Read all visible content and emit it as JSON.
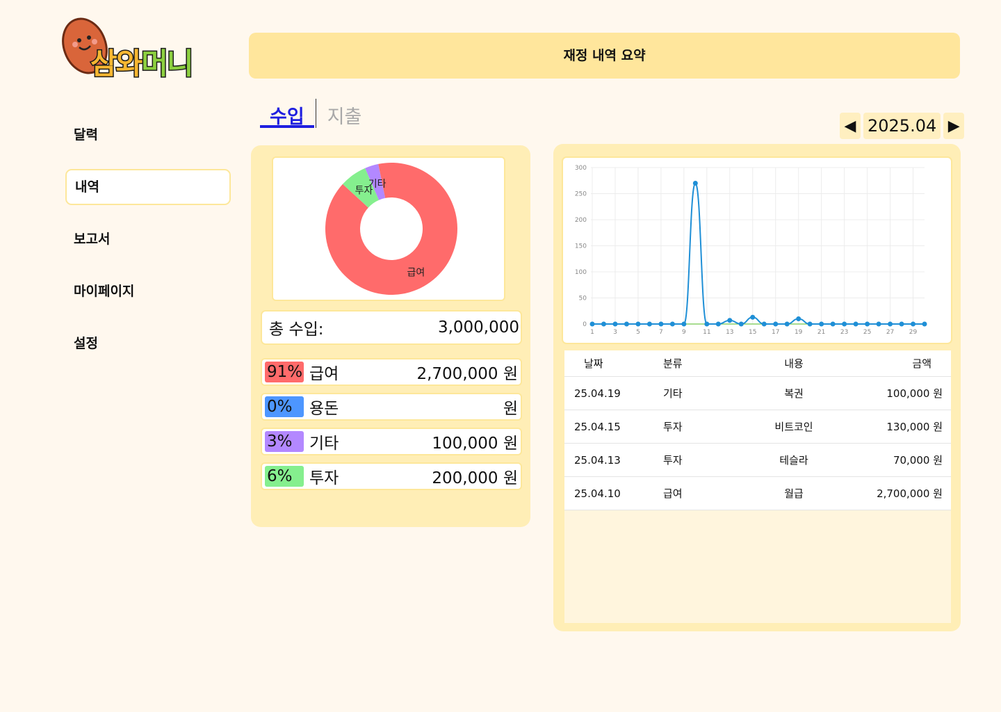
{
  "logo": {
    "text_part1": "삼와",
    "text_part2": "머니"
  },
  "sidebar": {
    "items": [
      {
        "label": "달력",
        "active": false
      },
      {
        "label": "내역",
        "active": true
      },
      {
        "label": "보고서",
        "active": false
      },
      {
        "label": "마이페이지",
        "active": false
      },
      {
        "label": "설정",
        "active": false
      }
    ]
  },
  "header": {
    "title": "재정 내역 요약"
  },
  "tabs": [
    {
      "label": "수입",
      "active": true
    },
    {
      "label": "지출",
      "active": false
    }
  ],
  "month_nav": {
    "prev": "◀",
    "label": "2025.04",
    "next": "▶"
  },
  "summary": {
    "total_label": "총 수입:",
    "total_value": "3,000,000",
    "categories": [
      {
        "pct": "91%",
        "name": "급여",
        "amount": "2,700,000 원",
        "color": "#ff6b6b"
      },
      {
        "pct": "0%",
        "name": "용돈",
        "amount": "원",
        "color": "#4d96ff"
      },
      {
        "pct": "3%",
        "name": "기타",
        "amount": "100,000 원",
        "color": "#b388ff"
      },
      {
        "pct": "6%",
        "name": "투자",
        "amount": "200,000 원",
        "color": "#85ef8e"
      }
    ]
  },
  "chart_data": [
    {
      "type": "pie",
      "variant": "donut",
      "labels": [
        "급여",
        "투자",
        "기타"
      ],
      "values": [
        2700000,
        200000,
        100000
      ],
      "colors": [
        "#ff6b6b",
        "#85ef8e",
        "#b388ff"
      ]
    },
    {
      "type": "line",
      "x": [
        1,
        2,
        3,
        4,
        5,
        6,
        7,
        8,
        9,
        10,
        11,
        12,
        13,
        14,
        15,
        16,
        17,
        18,
        19,
        20,
        21,
        22,
        23,
        24,
        25,
        26,
        27,
        28,
        29,
        30
      ],
      "x_tick_labels": [
        "1",
        "3",
        "5",
        "7",
        "9",
        "11",
        "13",
        "15",
        "17",
        "19",
        "21",
        "23",
        "25",
        "27",
        "29"
      ],
      "y_tick_labels": [
        "0",
        "50",
        "100",
        "150",
        "200",
        "250",
        "300"
      ],
      "ylim": [
        0,
        300
      ],
      "grid": true,
      "series": [
        {
          "color": "#1f8fd6",
          "values": [
            0,
            0,
            0,
            0,
            0,
            0,
            0,
            0,
            0,
            270,
            0,
            0,
            7,
            0,
            13,
            0,
            0,
            0,
            10,
            0,
            0,
            0,
            0,
            0,
            0,
            0,
            0,
            0,
            0,
            0
          ]
        },
        {
          "color": "#8bd16b",
          "values": [
            0,
            0,
            0,
            0,
            0,
            0,
            0,
            0,
            0,
            0,
            0,
            0,
            0,
            0,
            0,
            0,
            0,
            0,
            0,
            0,
            0,
            0,
            0,
            0,
            0,
            0,
            0,
            0,
            0,
            0
          ]
        }
      ]
    }
  ],
  "transactions": {
    "headers": {
      "date": "날짜",
      "category": "분류",
      "desc": "내용",
      "amount": "금액"
    },
    "rows": [
      {
        "date": "25.04.19",
        "category": "기타",
        "desc": "복권",
        "amount": "100,000 원"
      },
      {
        "date": "25.04.15",
        "category": "투자",
        "desc": "비트코인",
        "amount": "130,000 원"
      },
      {
        "date": "25.04.13",
        "category": "투자",
        "desc": "테슬라",
        "amount": "70,000 원"
      },
      {
        "date": "25.04.10",
        "category": "급여",
        "desc": "월급",
        "amount": "2,700,000 원"
      }
    ]
  }
}
